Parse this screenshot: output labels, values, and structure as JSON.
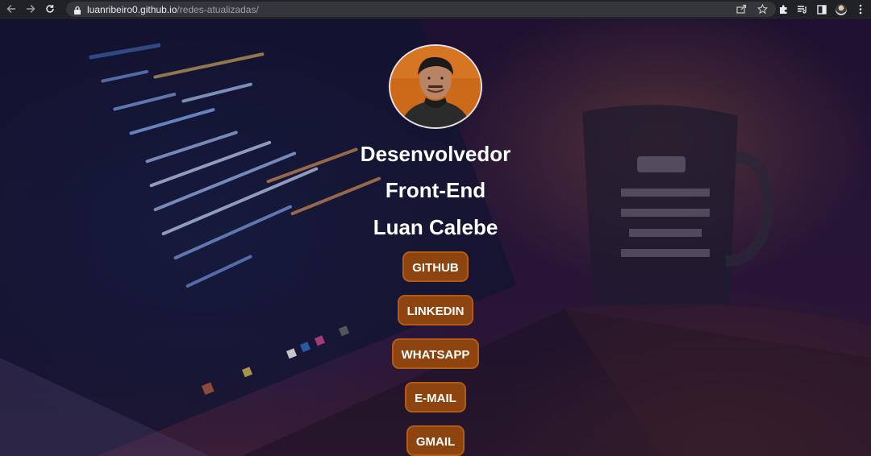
{
  "browser": {
    "url_host": "luanribeiro0.github.io",
    "url_path": "/redes-atualizadas/",
    "icons": {
      "back": "arrow-left-icon",
      "forward": "arrow-right-icon",
      "reload": "reload-icon",
      "lock": "lock-icon",
      "share": "share-icon",
      "bookmark": "star-icon",
      "extensions": "puzzle-icon",
      "media": "media-queue-icon",
      "side_panel": "side-panel-icon",
      "profile": "profile-avatar",
      "menu": "kebab-menu-icon"
    }
  },
  "profile": {
    "headline_1": "Desenvolvedor",
    "headline_2": "Front-End",
    "name": "Luan Calebe"
  },
  "links": [
    {
      "label": "GITHUB"
    },
    {
      "label": "LINKEDIN"
    },
    {
      "label": "WHATSAPP"
    },
    {
      "label": "E-MAIL"
    },
    {
      "label": "GMAIL"
    }
  ],
  "colors": {
    "button_bg": "#8e440f",
    "button_border": "#b25a16",
    "text": "#ffffff"
  }
}
